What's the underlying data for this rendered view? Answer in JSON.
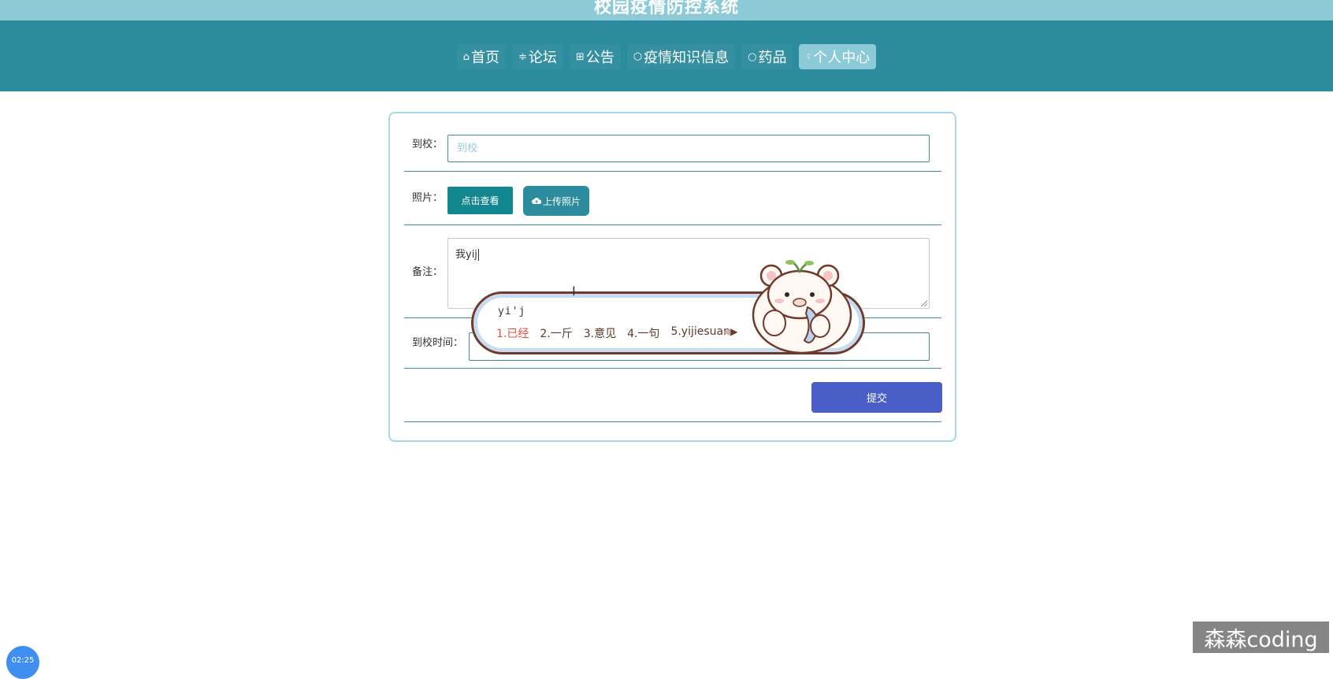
{
  "app": {
    "title": "校园疫情防控系统"
  },
  "nav": {
    "items": [
      {
        "icon": "home-icon",
        "glyph": "⌂",
        "label": "首页"
      },
      {
        "icon": "sliders-icon",
        "glyph": "≑",
        "label": "论坛"
      },
      {
        "icon": "grid-icon",
        "glyph": "⊞",
        "label": "公告"
      },
      {
        "icon": "cube-icon",
        "glyph": "⬡",
        "label": "疫情知识信息"
      },
      {
        "icon": "circle-icon",
        "glyph": "○",
        "label": "药品"
      },
      {
        "icon": "user-icon",
        "glyph": "⍤",
        "label": "个人中心"
      }
    ],
    "active_index": 5
  },
  "form": {
    "arrive": {
      "label": "到校：",
      "placeholder": "到校",
      "value": ""
    },
    "photo": {
      "label": "照片：",
      "view_button": "点击查看",
      "upload_button": "上传照片"
    },
    "remark": {
      "label": "备注：",
      "value": "我yij"
    },
    "arrive_time": {
      "label": "到校时间：",
      "value": ""
    },
    "submit_label": "提交"
  },
  "ime": {
    "composition": "yi'j",
    "candidates": [
      "1.已经",
      "2.一斤",
      "3.意见",
      "4.一句",
      "5.yijiesuan"
    ]
  },
  "timer": {
    "text": "02:25"
  },
  "watermark": {
    "text": "森森coding"
  },
  "colors": {
    "title_bar": "#8ccad8",
    "nav_bar": "#2c8c9e",
    "nav_active": "#8ccad8",
    "primary": "#13878f",
    "submit": "#4a5ec8",
    "ime_first_candidate": "#e0553f"
  }
}
